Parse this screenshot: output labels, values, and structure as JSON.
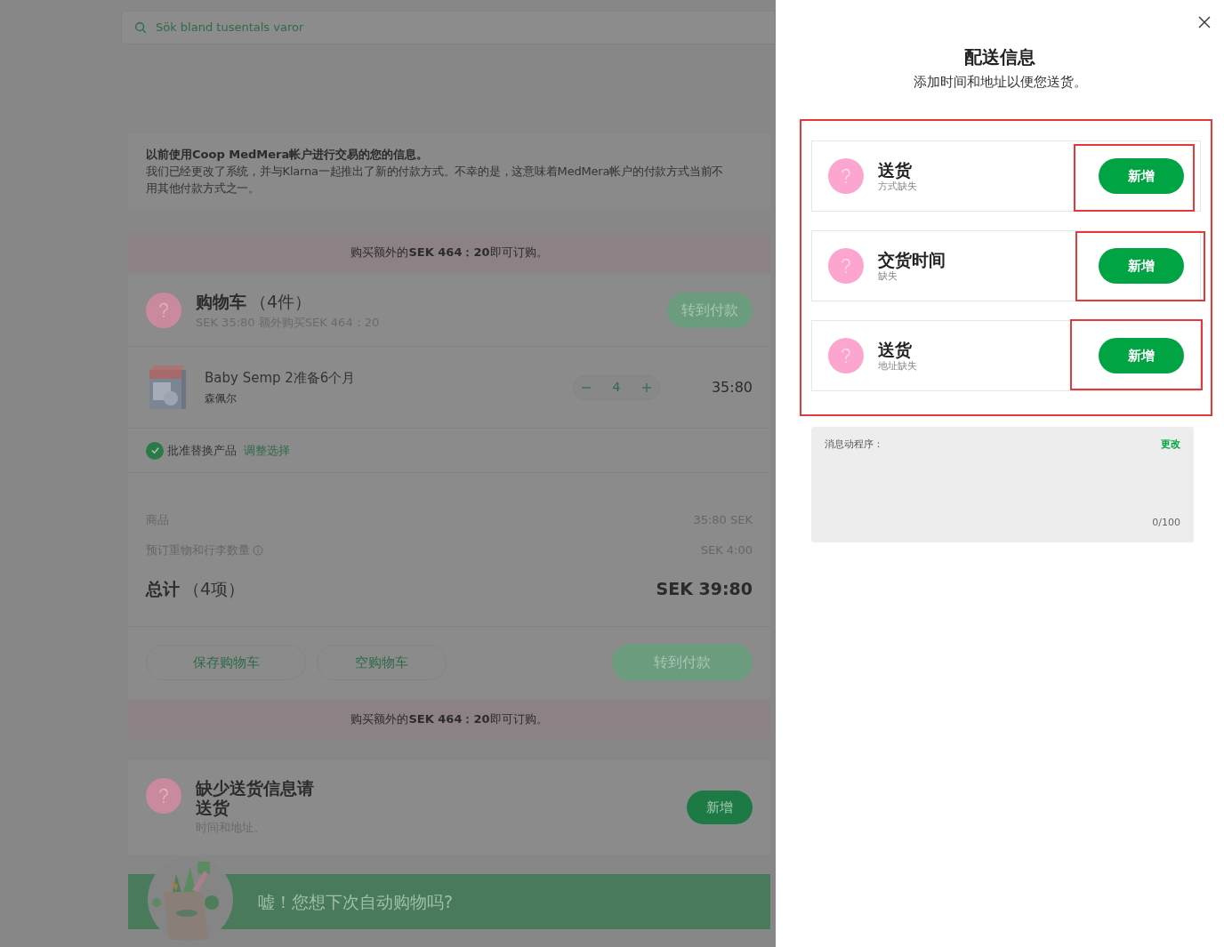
{
  "search": {
    "placeholder": "Sök bland tusentals varor"
  },
  "notice": {
    "title": "以前使用Coop MedMera帐户进行交易的您的信息。",
    "lines": [
      "我们已经更改了系统，并与Klarna一起推出了新的付款方式。不幸的是，这意味着MedMera帐户的付款方式当前不",
      "用其他付款方式之一。"
    ]
  },
  "min_order_banner_top": "购买额外的**SEK 464：20**即可订购。",
  "cart": {
    "title": "购物车",
    "count": "（4件）",
    "subtitle": "SEK 35:80 额外购买SEK 464：20",
    "checkout_button": {
      "label": "转到付款",
      "disabled": true
    }
  },
  "item": {
    "name": "Baby Semp 2准备6个月",
    "brand": "森佩尔",
    "quantity": "4",
    "price": "35:80"
  },
  "substitution": {
    "checked": true,
    "label": "批准替换产品",
    "link": "调整选择"
  },
  "summary": [
    {
      "kind": "line",
      "label": "商品",
      "value": "35:80 SEK",
      "info": false
    },
    {
      "kind": "line",
      "label": "预订重物和行李数量",
      "value": "SEK 4:00",
      "info": true
    },
    {
      "kind": "total",
      "label": "总计",
      "count": "（4项）",
      "value": "SEK 39:80"
    }
  ],
  "actions": {
    "save": "保存购物车",
    "empty": "空购物车",
    "checkout": {
      "label": "转到付款",
      "disabled": true
    }
  },
  "min_order_banner_bottom": "购买额外的**SEK 464：20**即可订购。",
  "delivery_missing": {
    "title": "缺少送货信息请送货",
    "subtitle": "时间和地址。",
    "button": "新增"
  },
  "promo": {
    "text": "嘘！您想下次自动购物吗?"
  },
  "drawer": {
    "title": "配送信息",
    "subtitle": "添加时间和地址以便您送货。",
    "highlighted": true,
    "steps": [
      {
        "title": "送货",
        "status": "方式缺失",
        "button": "新增",
        "highlighted": true
      },
      {
        "title": "交货时间",
        "status": "缺失",
        "button": "新增",
        "highlighted": true
      },
      {
        "title": "送货",
        "status": "地址缺失",
        "button": "新增",
        "highlighted": true
      }
    ],
    "note": {
      "label": "消息动程序：",
      "link": "更改",
      "counter": "0/100"
    }
  }
}
